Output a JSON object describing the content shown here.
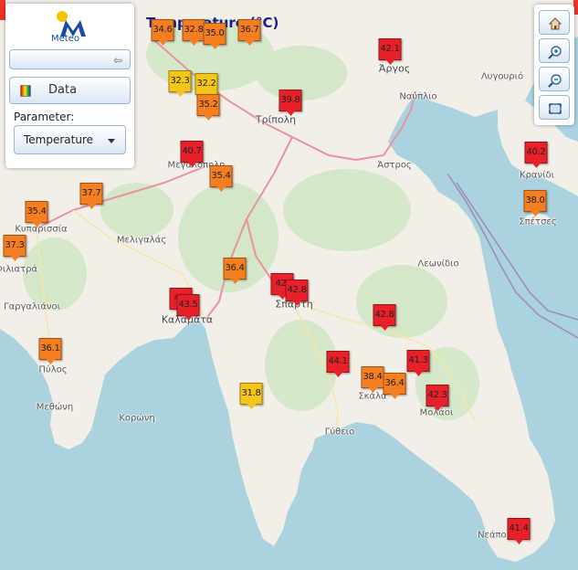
{
  "title": "Temperature (°C)",
  "panel": {
    "logo_text": "Meteo",
    "data_button_label": "Data",
    "parameter_label": "Parameter:",
    "parameter_value": "Temperature"
  },
  "colors": {
    "sea": "#aad3df",
    "land": "#f2efe9",
    "forest": "#cde6c2",
    "main_road": "#e892a2",
    "secondary_road": "#f7e6a8",
    "boundary": "#9e8ab0",
    "temp_yellow": "#f5c518",
    "temp_orange": "#f57f20",
    "temp_red": "#e8202a"
  },
  "places": [
    {
      "name": "Άργος",
      "kind": "city"
    },
    {
      "name": "Ναύπλιο",
      "kind": "town"
    },
    {
      "name": "Λυγουριό",
      "kind": "town"
    },
    {
      "name": "Τρίπολη",
      "kind": "city"
    },
    {
      "name": "Μεγαλόπολη",
      "kind": "town"
    },
    {
      "name": "Άστρος",
      "kind": "town"
    },
    {
      "name": "Κρανίδι",
      "kind": "town"
    },
    {
      "name": "Σπέτσες",
      "kind": "town"
    },
    {
      "name": "Κυπαρισσία",
      "kind": "town"
    },
    {
      "name": "Μελιγαλάς",
      "kind": "town"
    },
    {
      "name": "Φιλιατρά",
      "kind": "town"
    },
    {
      "name": "Λεωνίδιο",
      "kind": "town"
    },
    {
      "name": "Γαργαλιάνοι",
      "kind": "town"
    },
    {
      "name": "Καλαμάτα",
      "kind": "city"
    },
    {
      "name": "Σπάρτη",
      "kind": "city"
    },
    {
      "name": "Πύλος",
      "kind": "town"
    },
    {
      "name": "Μεθώνη",
      "kind": "town"
    },
    {
      "name": "Κορώνη",
      "kind": "town"
    },
    {
      "name": "Σκάλα",
      "kind": "town"
    },
    {
      "name": "Μολάοι",
      "kind": "town"
    },
    {
      "name": "Γύθειο",
      "kind": "town"
    },
    {
      "name": "Νεάπολη",
      "kind": "town"
    }
  ],
  "stations": [
    {
      "value": "34.6",
      "level": "orange"
    },
    {
      "value": "32.8",
      "level": "orange"
    },
    {
      "value": "35.0",
      "level": "orange"
    },
    {
      "value": "36.7",
      "level": "orange"
    },
    {
      "value": "42.1",
      "level": "red"
    },
    {
      "value": "32.3",
      "level": "yellow"
    },
    {
      "value": "32.2",
      "level": "yellow"
    },
    {
      "value": "35.2",
      "level": "orange"
    },
    {
      "value": "39.8",
      "level": "red"
    },
    {
      "value": "40.7",
      "level": "red"
    },
    {
      "value": "35.4",
      "level": "orange"
    },
    {
      "value": "40.2",
      "level": "red"
    },
    {
      "value": "38.0",
      "level": "orange"
    },
    {
      "value": "37.7",
      "level": "orange"
    },
    {
      "value": "35.4",
      "level": "orange"
    },
    {
      "value": "37.3",
      "level": "orange"
    },
    {
      "value": "36.4",
      "level": "orange"
    },
    {
      "value": "42.",
      "level": "red"
    },
    {
      "value": "42.8",
      "level": "red"
    },
    {
      "value": "43.",
      "level": "red"
    },
    {
      "value": "43.5",
      "level": "red"
    },
    {
      "value": "42.8",
      "level": "red"
    },
    {
      "value": "36.1",
      "level": "orange"
    },
    {
      "value": "44.1",
      "level": "red"
    },
    {
      "value": "41.3",
      "level": "red"
    },
    {
      "value": "38.4",
      "level": "orange"
    },
    {
      "value": "36.4",
      "level": "orange"
    },
    {
      "value": "42.3",
      "level": "red"
    },
    {
      "value": "31.8",
      "level": "yellow"
    },
    {
      "value": "41.4",
      "level": "red"
    }
  ],
  "map_controls": [
    "home-icon",
    "zoom-in-icon",
    "zoom-out-icon",
    "zoom-extent-icon"
  ]
}
